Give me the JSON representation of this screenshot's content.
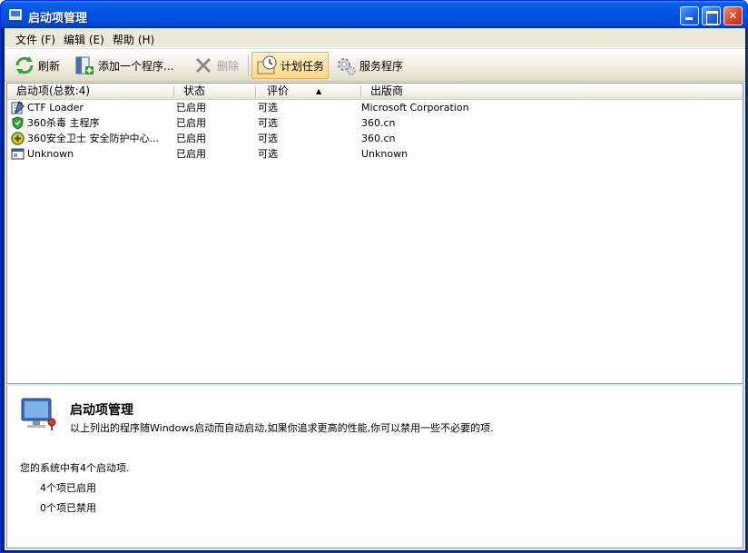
{
  "window": {
    "title": "启动项管理"
  },
  "menu": [
    {
      "label": "文件 (F)"
    },
    {
      "label": "编辑 (E)"
    },
    {
      "label": "帮助 (H)"
    }
  ],
  "toolbar": {
    "refresh": "刷新",
    "add_program": "添加一个程序...",
    "delete": "删除",
    "scheduled_tasks": "计划任务",
    "services": "服务程序"
  },
  "columns": [
    "启动项(总数:4)",
    "状态",
    "评价",
    "出版商"
  ],
  "rows": [
    {
      "name": "CTF Loader",
      "status": "已启用",
      "rating": "可选",
      "publisher": "Microsoft Corporation",
      "icon": "notepad-icon"
    },
    {
      "name": "360杀毒 主程序",
      "status": "已启用",
      "rating": "可选",
      "publisher": "360.cn",
      "icon": "shield-icon"
    },
    {
      "name": "360安全卫士 安全防护中心...",
      "status": "已启用",
      "rating": "可选",
      "publisher": "360.cn",
      "icon": "plus-circle-icon"
    },
    {
      "name": "Unknown",
      "status": "已启用",
      "rating": "可选",
      "publisher": "Unknown",
      "icon": "window-icon"
    }
  ],
  "detail": {
    "title": "启动项管理",
    "description": "以上列出的程序随Windows启动而自动启动,如果你追求更高的性能,你可以禁用一些不必要的项.",
    "summary": "您的系统中有4个启动项.",
    "enabled": "4个项已启用",
    "disabled": "0个项已禁用"
  }
}
